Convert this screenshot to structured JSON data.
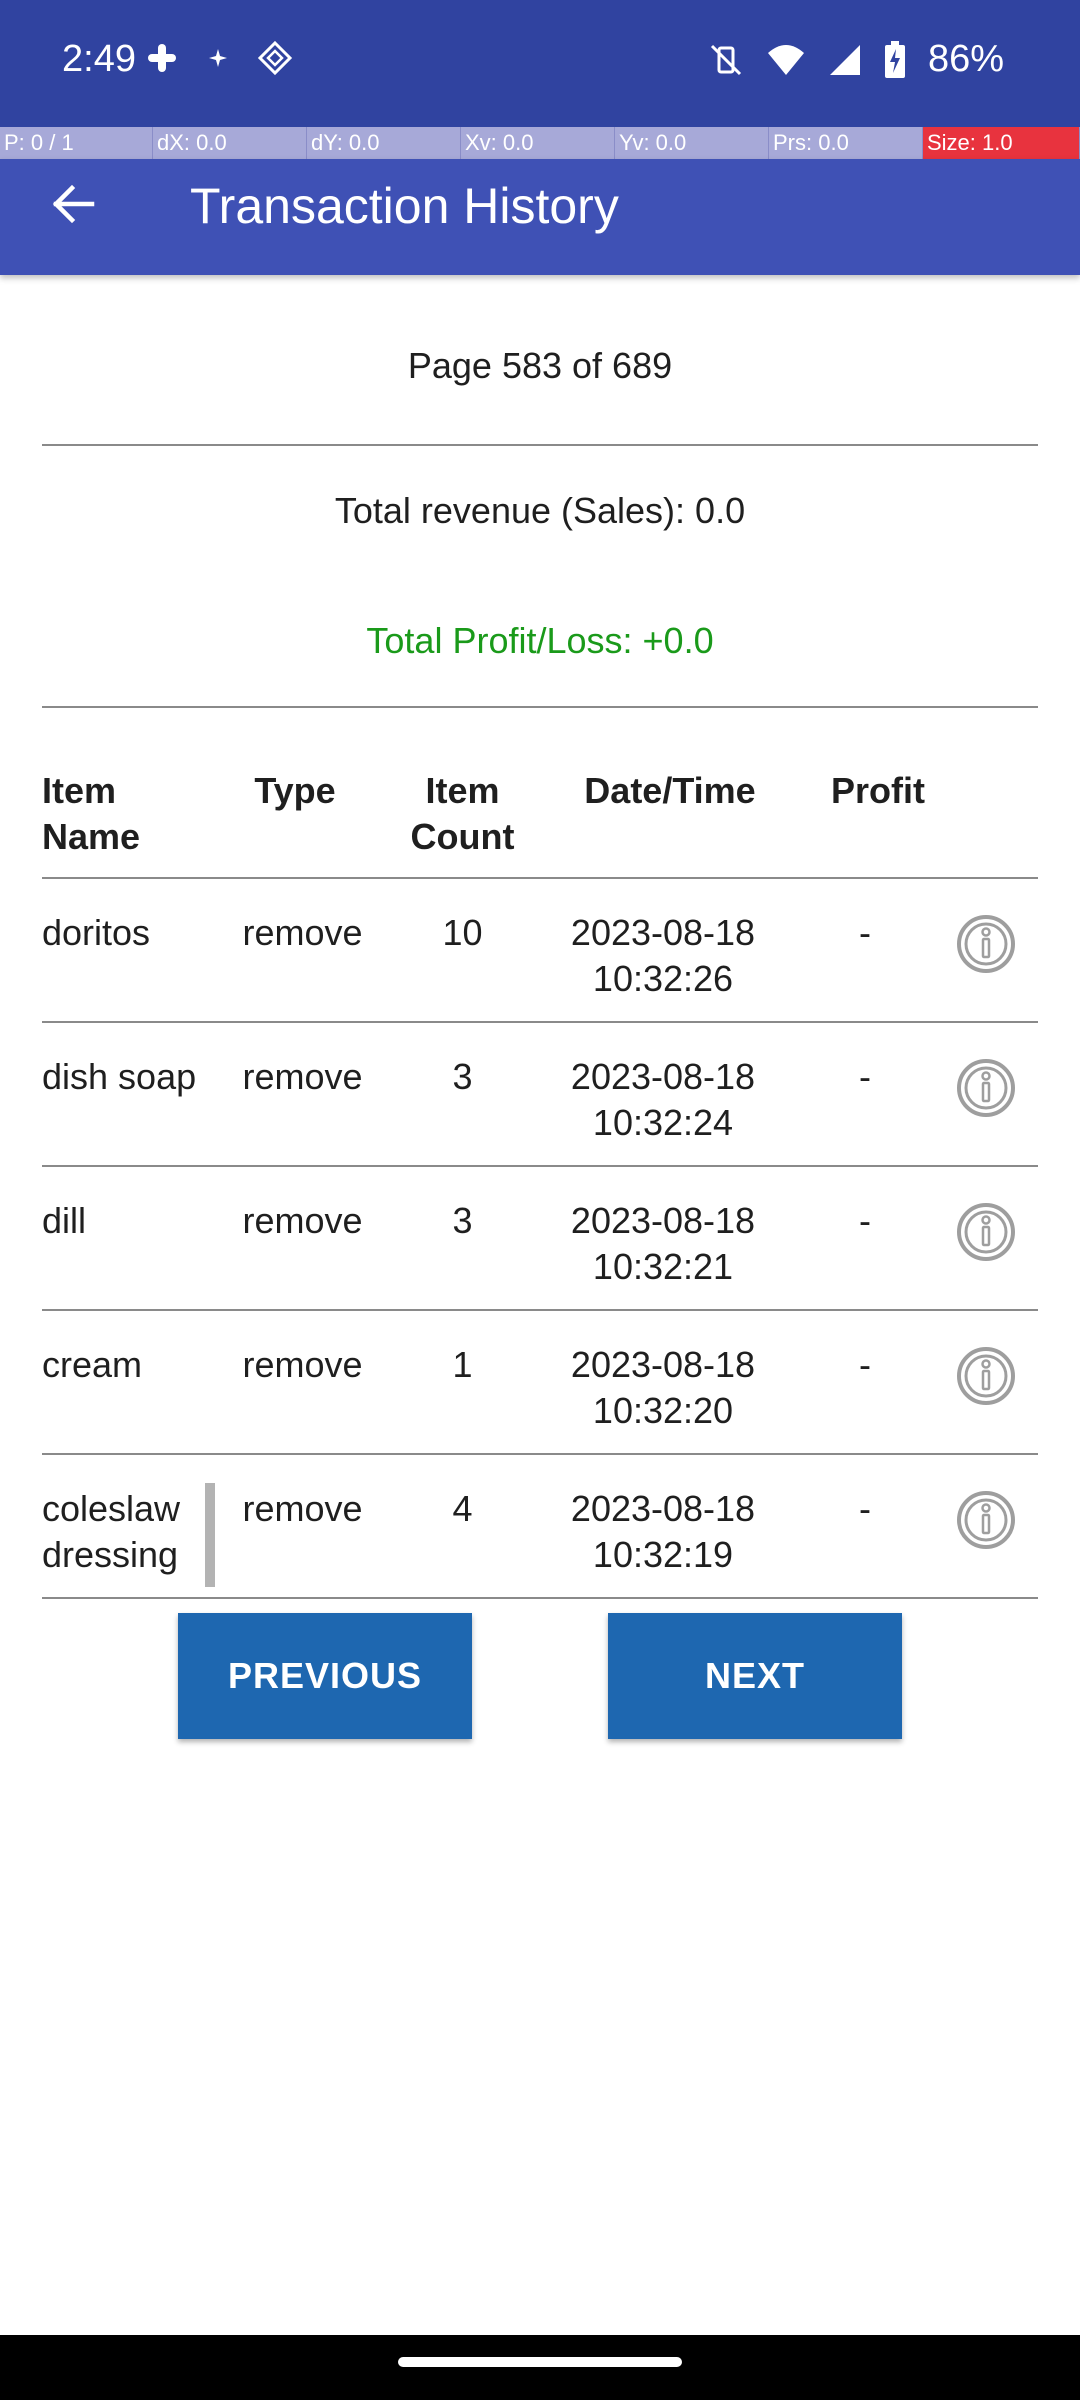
{
  "status_bar": {
    "time": "2:49",
    "left_icons": [
      "slack-icon",
      "sparkle-icon",
      "diamond-app-icon"
    ],
    "right_icons": [
      "mute-vibrate-icon",
      "wifi-icon",
      "signal-icon",
      "battery-charging-icon"
    ],
    "battery_percent": "86%"
  },
  "pointer_bar": {
    "p": "P: 0 / 1",
    "dx": "dX: 0.0",
    "dy": "dY: 0.0",
    "xv": "Xv: 0.0",
    "yv": "Yv: 0.0",
    "prs": "Prs: 0.0",
    "size": "Size: 1.0"
  },
  "app_bar": {
    "title": "Transaction History"
  },
  "page_indicator": "Page 583 of 689",
  "summary": {
    "revenue": "Total revenue (Sales): 0.0",
    "profit": "Total Profit/Loss: +0.0",
    "profit_color": "#1a9a1a"
  },
  "table": {
    "headers": {
      "item_name": "Item\nName",
      "type": "Type",
      "item_count": "Item\nCount",
      "datetime": "Date/Time",
      "profit": "Profit"
    },
    "rows": [
      {
        "name": "doritos",
        "type": "remove",
        "count": "10",
        "date": "2023-08-18",
        "time": "10:32:26",
        "profit": "-"
      },
      {
        "name": "dish soap",
        "type": "remove",
        "count": "3",
        "date": "2023-08-18",
        "time": "10:32:24",
        "profit": "-"
      },
      {
        "name": "dill",
        "type": "remove",
        "count": "3",
        "date": "2023-08-18",
        "time": "10:32:21",
        "profit": "-"
      },
      {
        "name": "cream",
        "type": "remove",
        "count": "1",
        "date": "2023-08-18",
        "time": "10:32:20",
        "profit": "-"
      },
      {
        "name": "coleslaw\ndressing",
        "type": "remove",
        "count": "4",
        "date": "2023-08-18",
        "time": "10:32:19",
        "profit": "-"
      }
    ]
  },
  "buttons": {
    "previous": "PREVIOUS",
    "next": "NEXT"
  },
  "colors": {
    "status_bar": "#3043a0",
    "app_bar": "#3f51b5",
    "button": "#1e67b0"
  }
}
